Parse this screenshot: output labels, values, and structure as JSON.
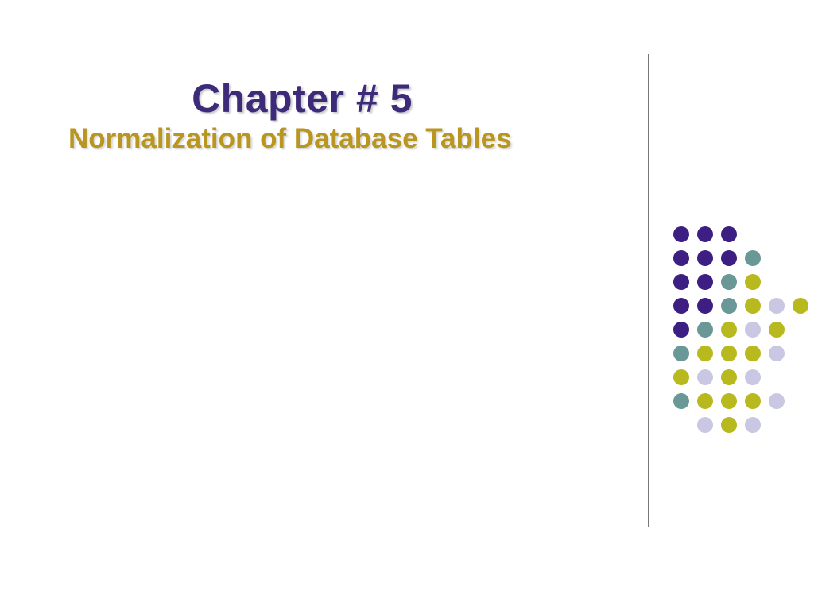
{
  "slide": {
    "title": "Chapter # 5",
    "subtitle": "Normalization of Database Tables"
  },
  "colors": {
    "title": "#3d2b7a",
    "subtitle": "#b8961f",
    "line": "#777777",
    "dot_purple": "#3d1e82",
    "dot_teal": "#6a9896",
    "dot_olive": "#b8b81f",
    "dot_lavender": "#c9c7e2"
  },
  "dot_pattern": [
    [
      "purple",
      "purple",
      "purple",
      "empty",
      "empty",
      "empty"
    ],
    [
      "purple",
      "purple",
      "purple",
      "teal",
      "empty",
      "empty"
    ],
    [
      "purple",
      "purple",
      "teal",
      "olive",
      "empty",
      "empty"
    ],
    [
      "purple",
      "purple",
      "teal",
      "olive",
      "lav",
      "olive"
    ],
    [
      "purple",
      "teal",
      "olive",
      "lav",
      "olive",
      "empty"
    ],
    [
      "teal",
      "olive",
      "olive",
      "olive",
      "lav",
      "empty"
    ],
    [
      "olive",
      "lav",
      "olive",
      "lav",
      "empty",
      "empty"
    ],
    [
      "teal",
      "olive",
      "olive",
      "olive",
      "lav",
      "empty"
    ],
    [
      "empty",
      "lav",
      "olive",
      "lav",
      "empty",
      "empty"
    ]
  ]
}
